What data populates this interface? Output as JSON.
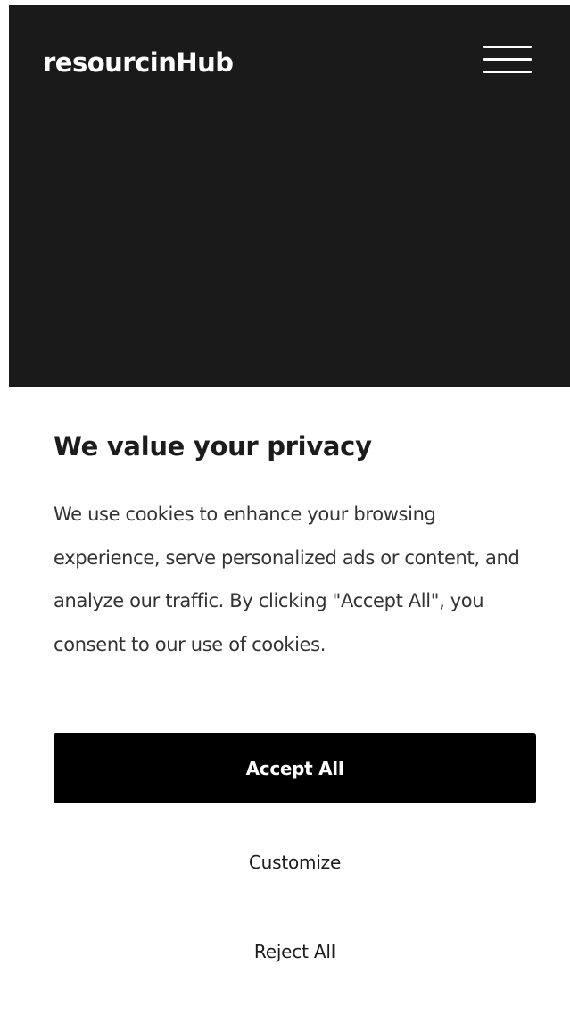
{
  "header": {
    "brand": "resourcinHub",
    "menu_icon": "hamburger-menu-icon"
  },
  "cookie_banner": {
    "title": "We value your privacy",
    "body": "We use cookies to enhance your browsing experience, serve personalized ads or content, and analyze our traffic. By clicking \"Accept All\", you consent to our use of cookies.",
    "accept_label": "Accept All",
    "customize_label": "Customize",
    "reject_label": "Reject All"
  },
  "colors": {
    "page_background": "#1a1a1a",
    "banner_background": "#ffffff",
    "primary_button": "#000000",
    "primary_button_text": "#ffffff",
    "text": "#1c1c1c"
  }
}
